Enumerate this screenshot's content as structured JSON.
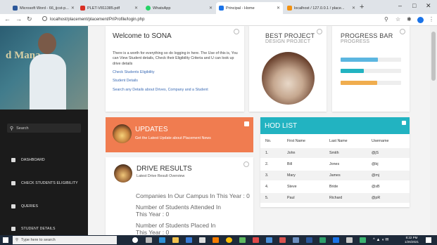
{
  "browser": {
    "tabs": [
      {
        "label": "Microsoft Word - 66_ijcst-p...",
        "color": "#2b579a"
      },
      {
        "label": "PLET-V811385.pdf",
        "color": "#d93025"
      },
      {
        "label": "WhatsApp",
        "color": "#25d366"
      },
      {
        "label": "Principal - Home",
        "color": "#1a73e8"
      },
      {
        "label": "localhost / 127.0.0.1 / place...",
        "color": "#f29111"
      }
    ],
    "new_tab": "+",
    "url": "localhost/placement/placement/PriProfile/login.php",
    "win_min": "–",
    "win_max": "□",
    "win_close": "✕"
  },
  "sidebar": {
    "hero_text": "d Mana",
    "search_placeholder": "Search",
    "items": [
      {
        "label": "DASHBOARD"
      },
      {
        "label": "CHECK STUDENTS ELIGIBILITY"
      },
      {
        "label": "QUERIES"
      },
      {
        "label": "STUDENT DETAILS"
      }
    ]
  },
  "welcome": {
    "title": "Welcome to SONA",
    "description": "There is a worth for everything so do logging in here. The Use of this is, You can View Student details, Check their Eligibility Criteria and U can look up drive details",
    "links": [
      "Check Students Eligibility",
      "Student Details",
      "Search any Details about Drives, Company and a Student"
    ]
  },
  "best_project": {
    "title": "BEST PROJECT",
    "subtitle": "DESIGN PROJECT"
  },
  "progress": {
    "title": "PROGRESS BAR",
    "subtitle": "PROGRESS",
    "bars": [
      {
        "value": 0.62,
        "color": "#5bb6e0"
      },
      {
        "value": 0.38,
        "color": "#22b3c1"
      },
      {
        "value": 0.6,
        "color": "#f0ad4e"
      }
    ]
  },
  "updates": {
    "title": "UPDATES",
    "subtitle": "Get the Latest Update about Placement News"
  },
  "drive": {
    "title": "DRIVE RESULTS",
    "subtitle": "Latest Drive Result Overview",
    "lines": [
      "Companies In Our Campus In This Year : 0",
      "Number of Students Attended In This Year : 0",
      "Number of Students Placed In This Year : 0"
    ]
  },
  "hod": {
    "title": "HOD LIST",
    "columns": [
      "No.",
      "First Name",
      "Last Name",
      "Username"
    ],
    "rows": [
      [
        "1.",
        "John",
        "Smith",
        "@jS"
      ],
      [
        "2.",
        "Bill",
        "Jones",
        "@bj"
      ],
      [
        "3.",
        "Mary",
        "James",
        "@mj"
      ],
      [
        "4.",
        "Steve",
        "Bride",
        "@sB"
      ],
      [
        "5.",
        "Paul",
        "Richard",
        "@pR"
      ]
    ]
  },
  "taskbar": {
    "search_placeholder": "Type here to search",
    "time": "8:22 PM",
    "date": "1/26/2021"
  }
}
